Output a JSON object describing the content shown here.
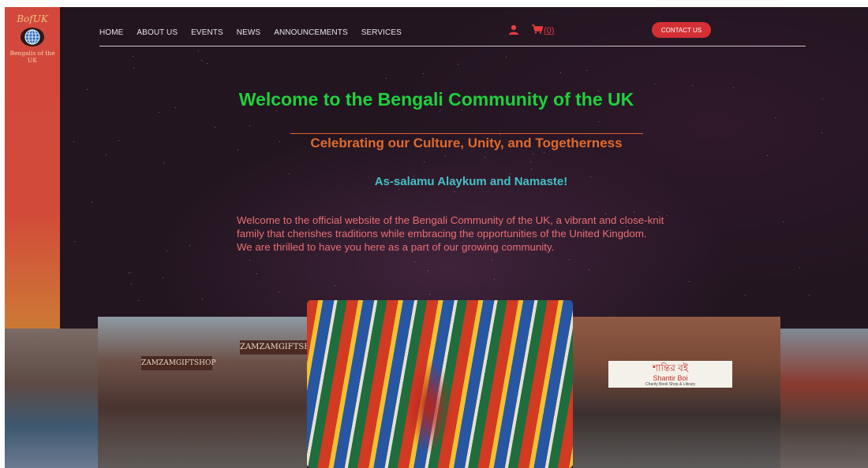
{
  "logo": {
    "text": "BofUK",
    "caption": "Bengalis of the UK"
  },
  "nav": {
    "items": [
      "HOME",
      "ABOUT US",
      "EVENTS",
      "NEWS",
      "ANNOUNCEMENTS",
      "SERVICES"
    ],
    "cart_count": "(0)",
    "contact_label": "CONTACT US"
  },
  "hero": {
    "title": "Welcome to the Bengali Community of the UK",
    "subtitle": "Celebrating our Culture, Unity, and Togetherness",
    "greeting": "As-salamu Alaykum and Namaste!",
    "intro_lines": [
      "Welcome to the official website of the Bengali Community of the UK, a vibrant and close-knit",
      "family that cherishes traditions while embracing the opportunities of the United Kingdom.",
      "We are thrilled to have you here as a part of our growing community."
    ]
  },
  "photos": {
    "zamzam_sign": "ZAMZAMGIFTSHOP",
    "zamzam_sign_left": "ZAMZAMGIFTSHOP",
    "shantir_bn": "শান্তির বই",
    "shantir_en": "Shantir Boi",
    "shantir_small": "Charity Book Shop & Library"
  },
  "colors": {
    "title": "#1fd13c",
    "subtitle": "#e06a2d",
    "greeting": "#44c1c8",
    "intro": "#e86f74",
    "contact_button": "#d42f35",
    "cart": "#e53d3d"
  }
}
